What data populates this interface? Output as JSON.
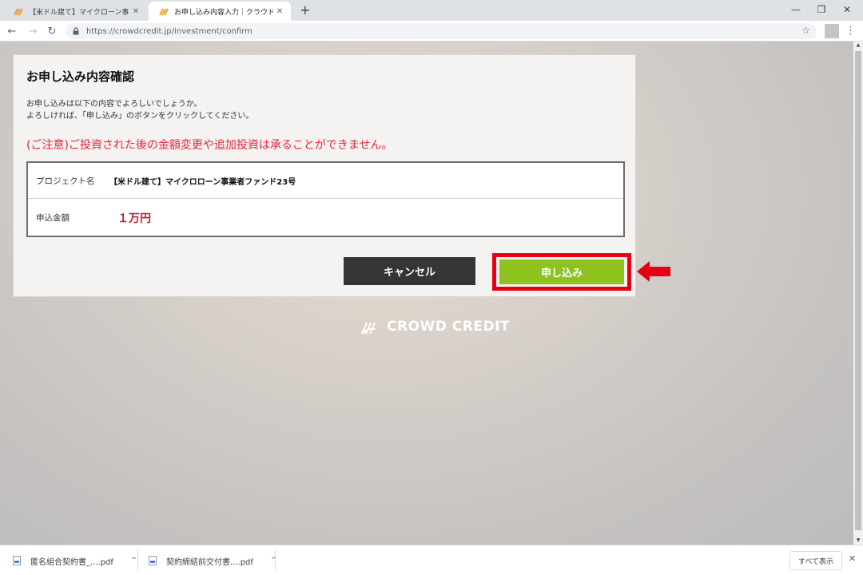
{
  "browser": {
    "tabs": [
      {
        "title": "【米ドル建て】マイクローン事業者フ",
        "active": false
      },
      {
        "title": "お申し込み内容入力｜クラウドクレジ",
        "active": true
      }
    ],
    "new_tab": "+",
    "close_glyph": "✕",
    "url": "https://crowdcredit.jp/investment/confirm",
    "window_controls": {
      "minimize": "—",
      "restore": "❐",
      "close": "✕"
    },
    "nav": {
      "back": "←",
      "forward": "→",
      "reload": "↻"
    },
    "star": "☆",
    "menu": "⋮"
  },
  "page": {
    "title": "お申し込み内容確認",
    "desc_line1": "お申し込みは以下の内容でよろしいでしょうか。",
    "desc_line2": "よろしければ、「申し込み」のボタンをクリックしてください。",
    "warning": "(ご注意)ご投資された後の金額変更や追加投資は承ることができません。",
    "project_label": "プロジェクト名",
    "project_value": "【米ドル建て】マイクロローン事業者ファンド23号",
    "amount_label": "申込金額",
    "amount_value": "１万円",
    "cancel_button": "キャンセル",
    "apply_button": "申し込み",
    "logo_text": "CROWD CREDIT"
  },
  "downloads": {
    "items": [
      {
        "name": "匿名組合契約書_....pdf"
      },
      {
        "name": "契約締結前交付書....pdf"
      }
    ],
    "caret": "^",
    "show_all": "すべて表示",
    "close": "✕"
  },
  "colors": {
    "warning": "#e8263a",
    "amount": "#b0212e",
    "apply": "#8dc21f",
    "cancel": "#353535",
    "highlight": "#e60012"
  }
}
